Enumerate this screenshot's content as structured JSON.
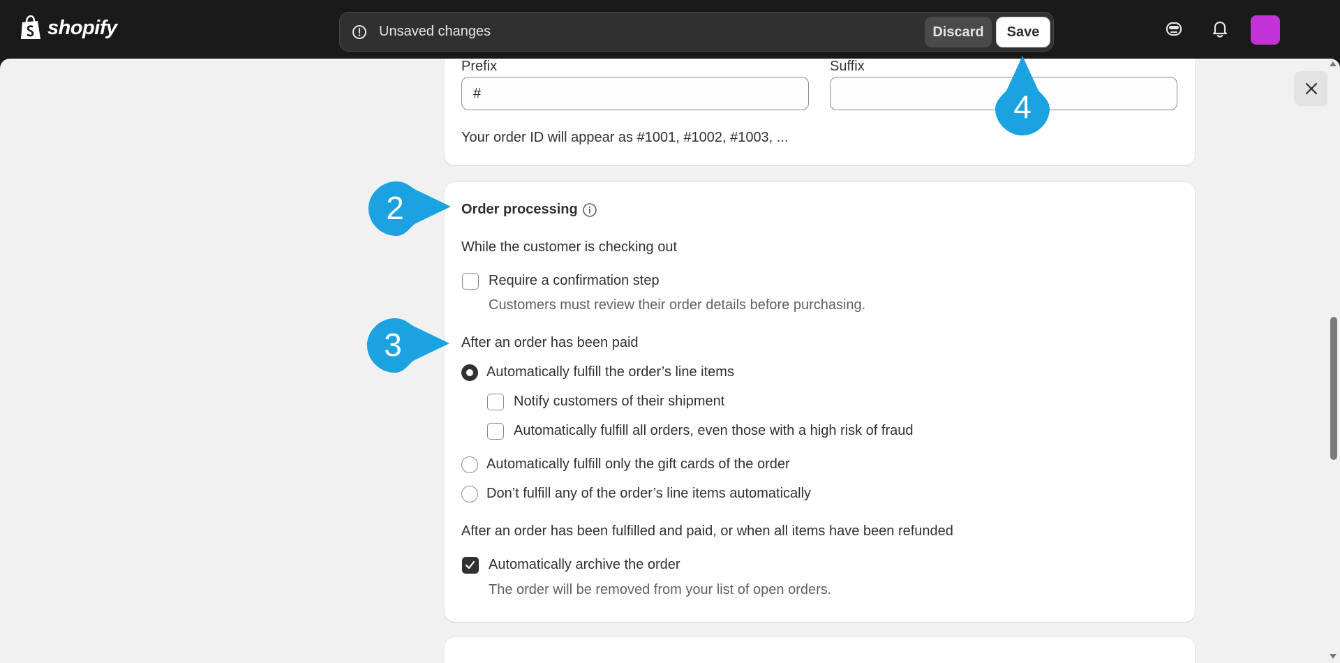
{
  "app": {
    "logo_text": "shopify"
  },
  "savebar": {
    "message": "Unsaved changes",
    "discard_label": "Discard",
    "save_label": "Save"
  },
  "order_id": {
    "prefix_label": "Prefix",
    "prefix_value": "#",
    "suffix_label": "Suffix",
    "suffix_value": "",
    "help": "Your order ID will appear as #1001, #1002, #1003, ..."
  },
  "order_processing": {
    "title": "Order processing",
    "checkout_heading": "While the customer is checking out",
    "confirm_label": "Require a confirmation step",
    "confirm_help": "Customers must review their order details before purchasing.",
    "paid_heading": "After an order has been paid",
    "options": [
      {
        "label": "Automatically fulfill the order’s line items",
        "selected": true
      },
      {
        "label": "Automatically fulfill only the gift cards of the order",
        "selected": false
      },
      {
        "label": "Don’t fulfill any of the order’s line items automatically",
        "selected": false
      }
    ],
    "notify_label": "Notify customers of their shipment",
    "fraud_label": "Automatically fulfill all orders, even those with a high risk of fraud",
    "fulfilled_heading": "After an order has been fulfilled and paid, or when all items have been refunded",
    "archive_label": "Automatically archive the order",
    "archive_help": "The order will be removed from your list of open orders."
  },
  "callouts": [
    "2",
    "3",
    "4"
  ],
  "colors": {
    "callout": "#1aa3e0",
    "avatar": "#c433d6",
    "topbar": "#1a1a1a"
  }
}
